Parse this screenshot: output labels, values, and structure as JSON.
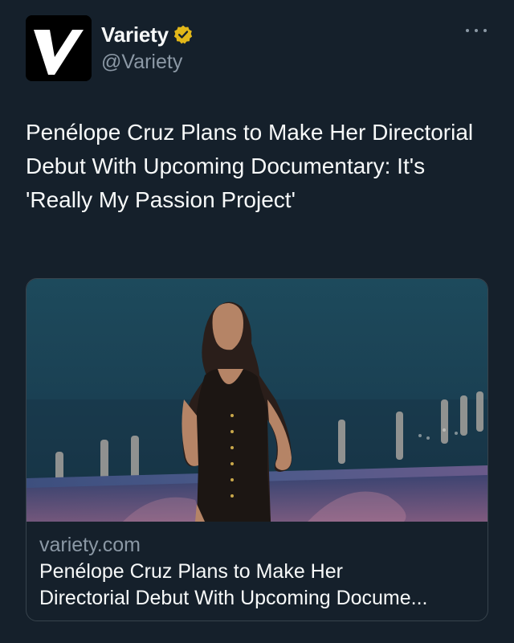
{
  "tweet": {
    "author": {
      "display_name": "Variety",
      "handle": "@Variety",
      "avatar_icon": "variety-v-logo",
      "verified_icon": "gold-verified-badge",
      "verified_color": "#e2b719"
    },
    "more_icon": "more-dots-icon",
    "text": "Penélope Cruz Plans to Make Her Directorial Debut With Upcoming Documentary: It's 'Really My Passion Project'",
    "card": {
      "domain": "variety.com",
      "title_line1": "Penélope Cruz Plans to Make Her",
      "title_line2": "Directorial Debut With Upcoming Docume...",
      "image_description_icon": "photo-woman-in-leather-dress-seaside-night"
    }
  },
  "colors": {
    "background": "#15202b",
    "text_primary": "#f7f9f9",
    "text_secondary": "#8b98a5",
    "card_border": "#38444d"
  }
}
